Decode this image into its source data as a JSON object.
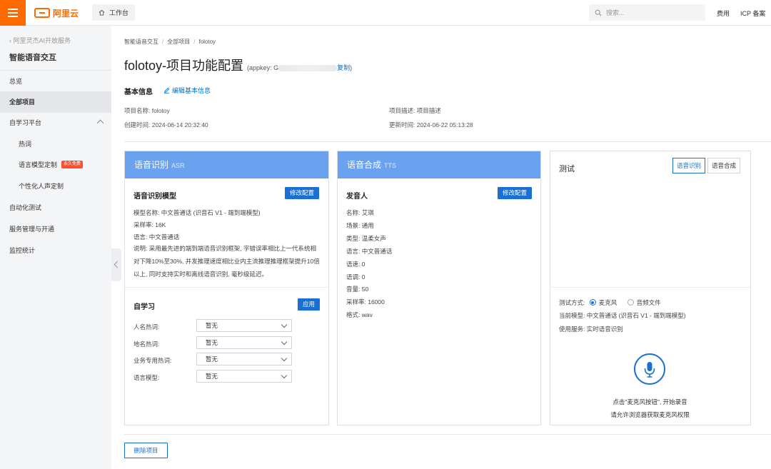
{
  "topbar": {
    "logo_text": "阿里云",
    "workbench": "工作台",
    "search_placeholder": "搜索...",
    "links": [
      "费用",
      "ICP 备案"
    ]
  },
  "sidebar": {
    "back": "阿里灵杰AI开放服务",
    "title": "智能语音交互",
    "items": [
      {
        "label": "总览"
      },
      {
        "label": "全部项目",
        "active": true
      },
      {
        "label": "自学习平台",
        "expandable": true
      },
      {
        "label": "热词",
        "sub": true
      },
      {
        "label": "语言模型定制",
        "sub": true,
        "badge": "永久免费"
      },
      {
        "label": "个性化人声定制",
        "sub": true
      },
      {
        "label": "自动化测试"
      },
      {
        "label": "服务管理与开通"
      },
      {
        "label": "监控统计"
      }
    ]
  },
  "breadcrumb": [
    "智能语音交互",
    "全部项目",
    "folotoy"
  ],
  "page": {
    "title": "folotoy-项目功能配置",
    "appkey_prefix": "(appkey: G",
    "appkey_copy": "复制",
    "appkey_suffix": ")"
  },
  "basic_info": {
    "title": "基本信息",
    "edit_label": "编辑基本信息",
    "name": "项目名称: folotoy",
    "created": "创建时间: 2024-06-14 20:32:40",
    "desc": "项目描述: 项目描述",
    "updated": "更新时间: 2024-06-22 05:13:28"
  },
  "asr": {
    "title": "语音识别",
    "title_en": "ASR",
    "model_title": "语音识别模型",
    "modify": "修改配置",
    "lines": [
      "模型名称: 中文普通话 (识音石 V1 - 端到端模型)",
      "采样率: 16K",
      "语言: 中文普通话"
    ],
    "description": "说明: 采用最先进的端到端语音识别框架, 字错误率相比上一代系统相对下降10%至30%, 并发推理速度相比业内主流推理推理框架提升10倍以上, 同时支持实时和离线语音识别, 毫秒级延迟。",
    "self_learning": "自学习",
    "apply": "应用",
    "selects": [
      {
        "label": "人名热词:",
        "value": "暂无"
      },
      {
        "label": "地名热词:",
        "value": "暂无"
      },
      {
        "label": "业务专用热词:",
        "value": "暂无"
      },
      {
        "label": "语言模型:",
        "value": "暂无"
      }
    ]
  },
  "tts": {
    "title": "语音合成",
    "title_en": "TTS",
    "speaker_title": "发音人",
    "modify": "修改配置",
    "lines": [
      "名称: 艾琪",
      "场景: 通用",
      "类型: 温柔女声",
      "语言: 中文普通话",
      "语速: 0",
      "语调: 0",
      "音量: 50",
      "采样率: 16000",
      "格式: wav"
    ]
  },
  "test": {
    "title": "测试",
    "tabs": [
      "语音识别",
      "语音合成"
    ],
    "method_label": "测试方式:",
    "option_mic": "麦克风",
    "option_file": "音频文件",
    "current_model": "当前模型: 中文普通话 (识音石 V1 - 端到端模型)",
    "service": "使用服务: 实时语音识别",
    "hint1": "点击\"麦克风按钮\", 开始录音",
    "hint2": "请允许浏览器获取麦克风权限"
  },
  "delete_label": "删除项目"
}
